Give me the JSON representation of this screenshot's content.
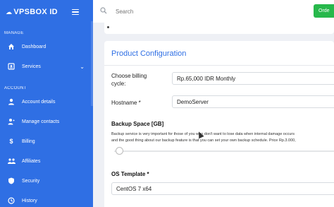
{
  "brand": {
    "name": "VPSBOX ID"
  },
  "sidebar": {
    "manage_label": "MANAGE",
    "account_label": "ACCOUNT",
    "manage_items": [
      {
        "label": "Dashboard",
        "icon": "home-icon"
      },
      {
        "label": "Services",
        "icon": "services-icon"
      }
    ],
    "account_items": [
      {
        "label": "Account details",
        "icon": "user-icon"
      },
      {
        "label": "Manage contacts",
        "icon": "contacts-icon"
      },
      {
        "label": "Billing",
        "icon": "dollar-icon"
      },
      {
        "label": "Affiliates",
        "icon": "affiliates-icon"
      },
      {
        "label": "Security",
        "icon": "shield-icon"
      },
      {
        "label": "History",
        "icon": "history-icon"
      }
    ]
  },
  "topbar": {
    "search_placeholder": "Search",
    "order_label": "Orde"
  },
  "card": {
    "title": "Product Configuration",
    "billing_label": "Choose billing cycle:",
    "billing_value": "Rp.65,000 IDR Monthly",
    "hostname_label": "Hostname *",
    "hostname_value": "DemoServer",
    "backup_title": "Backup Space [GB]",
    "backup_desc_1": "Backup service is very important for those of you who don't want to lose data when internal damage occurs",
    "backup_desc_2": "and the good thing about our backup feature is that you can set your own backup schedule. Price Rp.3.000,",
    "os_title": "OS Template *",
    "os_value": "CentOS 7 x64"
  },
  "colors": {
    "primary": "#2f6fe4",
    "success": "#27b84b"
  }
}
